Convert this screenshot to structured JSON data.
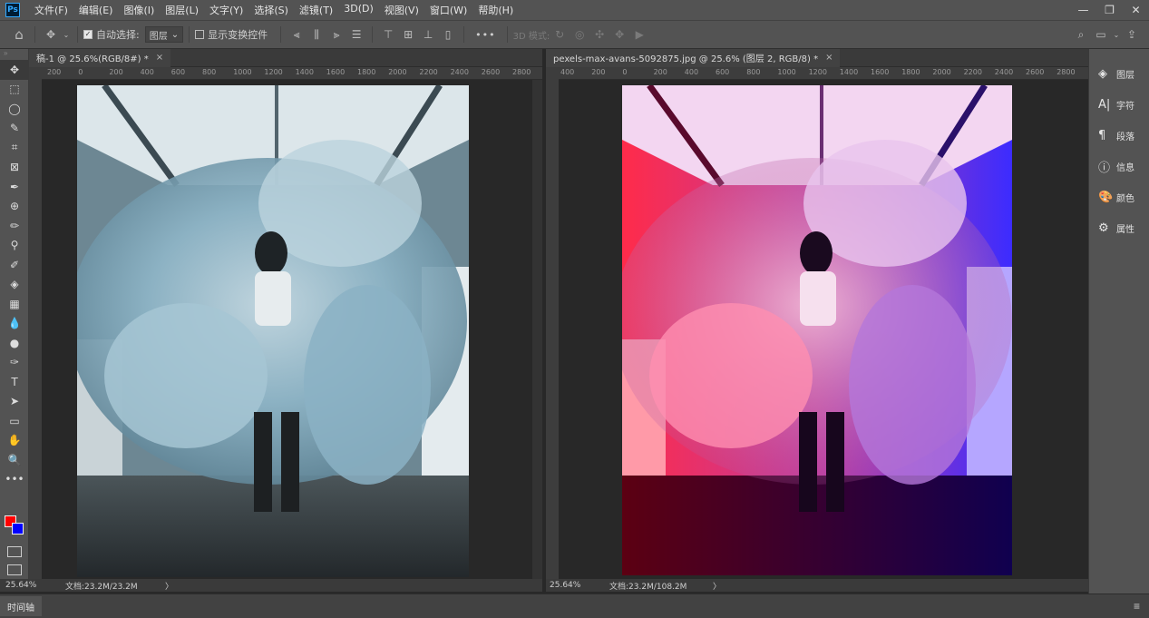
{
  "menubar": {
    "logo": "Ps",
    "items": [
      "文件(F)",
      "编辑(E)",
      "图像(I)",
      "图层(L)",
      "文字(Y)",
      "选择(S)",
      "滤镜(T)",
      "3D(D)",
      "视图(V)",
      "窗口(W)",
      "帮助(H)"
    ]
  },
  "window_controls": {
    "minimize": "—",
    "restore": "❐",
    "close": "✕"
  },
  "options": {
    "auto_select_label": "自动选择:",
    "auto_select_value": "图层",
    "show_transform_label": "显示变换控件",
    "more": "•••",
    "mode_3d": "3D 模式:"
  },
  "tools": [
    "move",
    "marquee",
    "lasso",
    "quick-select",
    "crop",
    "frame",
    "eyedropper",
    "healing",
    "brush",
    "stamp",
    "history-brush",
    "eraser",
    "gradient",
    "blur",
    "dodge",
    "pen",
    "type",
    "path-select",
    "rectangle",
    "hand",
    "zoom",
    "more"
  ],
  "tool_glyphs": [
    "✥",
    "⬚",
    "◯",
    "✎",
    "⌗",
    "⊠",
    "✒",
    "⊕",
    "✏",
    "⚲",
    "✐",
    "◈",
    "▦",
    "💧",
    "●",
    "✑",
    "T",
    "➤",
    "▭",
    "✋",
    "🔍",
    "•••"
  ],
  "colors": {
    "foreground": "#ff0000",
    "background": "#0000ff"
  },
  "doc_left": {
    "tab": "稿-1 @ 25.6%(RGB/8#) *",
    "close": "×",
    "ruler": [
      "200",
      "0",
      "200",
      "400",
      "600",
      "800",
      "1000",
      "1200",
      "1400",
      "1600",
      "1800",
      "2000",
      "2200",
      "2400",
      "2600",
      "2800"
    ],
    "zoom": "25.64%",
    "doc_info": "文档:23.2M/23.2M",
    "arrow": "〉"
  },
  "doc_right": {
    "tab": "pexels-max-avans-5092875.jpg @ 25.6% (图层 2, RGB/8) *",
    "close": "×",
    "ruler": [
      "400",
      "200",
      "0",
      "200",
      "400",
      "600",
      "800",
      "1000",
      "1200",
      "1400",
      "1600",
      "1800",
      "2000",
      "2200",
      "2400",
      "2600",
      "2800"
    ],
    "zoom": "25.64%",
    "doc_info": "文档:23.2M/108.2M",
    "arrow": "〉"
  },
  "dock": [
    {
      "label": "图层",
      "icon": "layers-icon",
      "glyph": "◈"
    },
    {
      "label": "字符",
      "icon": "character-icon",
      "glyph": "A|"
    },
    {
      "label": "段落",
      "icon": "paragraph-icon",
      "glyph": "¶"
    },
    {
      "label": "信息",
      "icon": "info-icon",
      "glyph": "ⓘ"
    },
    {
      "label": "颜色",
      "icon": "color-icon",
      "glyph": "🎨"
    },
    {
      "label": "属性",
      "icon": "properties-icon",
      "glyph": "⚙"
    }
  ],
  "timeline": {
    "label": "时间轴",
    "menu": "≡"
  }
}
